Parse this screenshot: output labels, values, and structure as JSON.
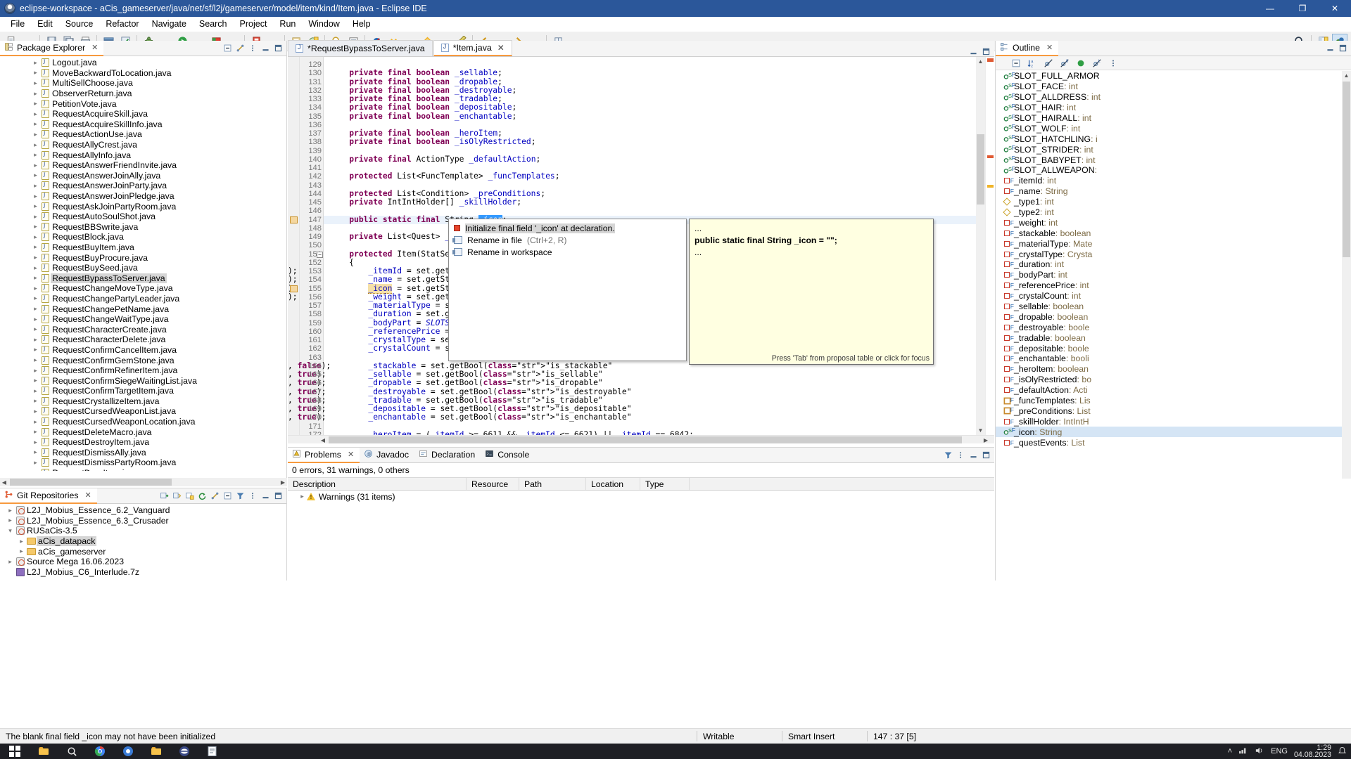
{
  "window": {
    "title": "eclipse-workspace - aCis_gameserver/java/net/sf/l2j/gameserver/model/item/kind/Item.java - Eclipse IDE",
    "minimize": "—",
    "maximize": "❐",
    "close": "✕"
  },
  "menubar": {
    "items": [
      "File",
      "Edit",
      "Source",
      "Refactor",
      "Navigate",
      "Search",
      "Project",
      "Run",
      "Window",
      "Help"
    ]
  },
  "toolbar": {
    "icons": [
      "new-icon",
      "new-dropdown-icon",
      "save-icon",
      "save-all-icon",
      "print-icon",
      "build-all-icon",
      "build-project-icon",
      "debug-icon",
      "run-icon",
      "coverage-icon",
      "external-tools-icon",
      "new-java-project-icon",
      "new-class-icon",
      "search-icon",
      "open-task-icon",
      "skip-breakpoints-icon",
      "next-annotation-icon",
      "previous-annotation-icon",
      "last-edit-location-icon",
      "back-icon",
      "forward-icon",
      "pin-editor-icon"
    ],
    "right_icons": [
      "quick-access-search-icon",
      "open-perspective-icon",
      "java-perspective-icon"
    ]
  },
  "package_explorer": {
    "tab_label": "Package Explorer",
    "close_label": "✕",
    "tools": [
      "collapse-all-icon",
      "link-with-editor-icon",
      "view-menu-icon",
      "minimize-icon",
      "maximize-icon"
    ],
    "items": [
      {
        "label": "Logout.java",
        "selected": false
      },
      {
        "label": "MoveBackwardToLocation.java",
        "selected": false
      },
      {
        "label": "MultiSellChoose.java",
        "selected": false
      },
      {
        "label": "ObserverReturn.java",
        "selected": false
      },
      {
        "label": "PetitionVote.java",
        "selected": false
      },
      {
        "label": "RequestAcquireSkill.java",
        "selected": false
      },
      {
        "label": "RequestAcquireSkillInfo.java",
        "selected": false
      },
      {
        "label": "RequestActionUse.java",
        "selected": false
      },
      {
        "label": "RequestAllyCrest.java",
        "selected": false
      },
      {
        "label": "RequestAllyInfo.java",
        "selected": false
      },
      {
        "label": "RequestAnswerFriendInvite.java",
        "selected": false
      },
      {
        "label": "RequestAnswerJoinAlly.java",
        "selected": false
      },
      {
        "label": "RequestAnswerJoinParty.java",
        "selected": false
      },
      {
        "label": "RequestAnswerJoinPledge.java",
        "selected": false
      },
      {
        "label": "RequestAskJoinPartyRoom.java",
        "selected": false
      },
      {
        "label": "RequestAutoSoulShot.java",
        "selected": false
      },
      {
        "label": "RequestBBSwrite.java",
        "selected": false
      },
      {
        "label": "RequestBlock.java",
        "selected": false
      },
      {
        "label": "RequestBuyItem.java",
        "selected": false
      },
      {
        "label": "RequestBuyProcure.java",
        "selected": false
      },
      {
        "label": "RequestBuySeed.java",
        "selected": false
      },
      {
        "label": "RequestBypassToServer.java",
        "selected": true
      },
      {
        "label": "RequestChangeMoveType.java",
        "selected": false
      },
      {
        "label": "RequestChangePartyLeader.java",
        "selected": false
      },
      {
        "label": "RequestChangePetName.java",
        "selected": false
      },
      {
        "label": "RequestChangeWaitType.java",
        "selected": false
      },
      {
        "label": "RequestCharacterCreate.java",
        "selected": false
      },
      {
        "label": "RequestCharacterDelete.java",
        "selected": false
      },
      {
        "label": "RequestConfirmCancelItem.java",
        "selected": false
      },
      {
        "label": "RequestConfirmGemStone.java",
        "selected": false
      },
      {
        "label": "RequestConfirmRefinerItem.java",
        "selected": false
      },
      {
        "label": "RequestConfirmSiegeWaitingList.java",
        "selected": false
      },
      {
        "label": "RequestConfirmTargetItem.java",
        "selected": false
      },
      {
        "label": "RequestCrystallizeItem.java",
        "selected": false
      },
      {
        "label": "RequestCursedWeaponList.java",
        "selected": false
      },
      {
        "label": "RequestCursedWeaponLocation.java",
        "selected": false
      },
      {
        "label": "RequestDeleteMacro.java",
        "selected": false
      },
      {
        "label": "RequestDestroyItem.java",
        "selected": false
      },
      {
        "label": "RequestDismissAlly.java",
        "selected": false
      },
      {
        "label": "RequestDismissPartyRoom.java",
        "selected": false
      },
      {
        "label": "RequestDropItem.java",
        "selected": false
      }
    ]
  },
  "git_repositories": {
    "tab_label": "Git Repositories",
    "close_label": "✕",
    "tools": [
      "add-repo-icon",
      "clone-repo-icon",
      "create-repo-icon",
      "refresh-icon",
      "link-icon",
      "collapse-all-icon",
      "filter-icon",
      "view-menu-icon",
      "minimize-icon",
      "maximize-icon"
    ],
    "items": [
      {
        "label": "L2J_Mobius_Essence_6.2_Vanguard",
        "indent": 0,
        "icon": "repo-icon",
        "arrow": true,
        "selected": false
      },
      {
        "label": "L2J_Mobius_Essence_6.3_Crusader",
        "indent": 0,
        "icon": "repo-icon",
        "arrow": true,
        "selected": false
      },
      {
        "label": "RUSaCis-3.5",
        "indent": 0,
        "icon": "repo-icon",
        "arrow": true,
        "expanded": true,
        "selected": false
      },
      {
        "label": "aCis_datapack",
        "indent": 1,
        "icon": "folder-icon",
        "arrow": true,
        "selected": true
      },
      {
        "label": "aCis_gameserver",
        "indent": 1,
        "icon": "folder-icon",
        "arrow": true,
        "selected": false
      },
      {
        "label": "Source Mega 16.06.2023",
        "indent": 0,
        "icon": "repo-icon",
        "arrow": true,
        "selected": false
      },
      {
        "label": "L2J_Mobius_C6_Interlude.7z",
        "indent": 0,
        "icon": "archive-icon",
        "arrow": false,
        "selected": false
      }
    ]
  },
  "editor": {
    "tabs": [
      {
        "label": "*RequestBypassToServer.java",
        "active": false,
        "closable": false
      },
      {
        "label": "*Item.java",
        "active": true,
        "closable": true
      }
    ],
    "close_label": "✕",
    "tools": [
      "minimize-icon",
      "maximize-icon"
    ],
    "first_line": 129,
    "lines": [
      {
        "n": 129,
        "text": ""
      },
      {
        "n": 130,
        "text": "    private final boolean _sellable;"
      },
      {
        "n": 131,
        "text": "    private final boolean _dropable;"
      },
      {
        "n": 132,
        "text": "    private final boolean _destroyable;"
      },
      {
        "n": 133,
        "text": "    private final boolean _tradable;"
      },
      {
        "n": 134,
        "text": "    private final boolean _depositable;"
      },
      {
        "n": 135,
        "text": "    private final boolean _enchantable;"
      },
      {
        "n": 136,
        "text": ""
      },
      {
        "n": 137,
        "text": "    private final boolean _heroItem;"
      },
      {
        "n": 138,
        "text": "    private final boolean _isOlyRestricted;"
      },
      {
        "n": 139,
        "text": ""
      },
      {
        "n": 140,
        "text": "    private final ActionType _defaultAction;"
      },
      {
        "n": 141,
        "text": ""
      },
      {
        "n": 142,
        "text": "    protected List<FuncTemplate> _funcTemplates;"
      },
      {
        "n": 143,
        "text": ""
      },
      {
        "n": 144,
        "text": "    protected List<Condition> _preConditions;"
      },
      {
        "n": 145,
        "text": "    private IntIntHolder[] _skillHolder;"
      },
      {
        "n": 146,
        "text": ""
      },
      {
        "n": 147,
        "text": "    public static final String _icon;"
      },
      {
        "n": 148,
        "text": ""
      },
      {
        "n": 149,
        "text": "    private List<Quest> _questEvents;"
      },
      {
        "n": 150,
        "text": ""
      },
      {
        "n": 151,
        "text": "    protected Item(StatSet set)"
      },
      {
        "n": 152,
        "text": "    {"
      },
      {
        "n": 153,
        "text": "        _itemId = set.getInteger(\"item_id\");"
      },
      {
        "n": 154,
        "text": "        _name = set.getString(\"name\");"
      },
      {
        "n": 155,
        "text": "        _icon = set.getString(\"icon\");"
      },
      {
        "n": 156,
        "text": "        _weight = set.getInteger(\"weight\");"
      },
      {
        "n": 157,
        "text": "        _materialType = set.getEnum(...);"
      },
      {
        "n": 158,
        "text": "        _duration = set.getInteger(...);"
      },
      {
        "n": 159,
        "text": "        _bodyPart = SLOTS.get(set...);"
      },
      {
        "n": 160,
        "text": "        _referencePrice = set.ge..."
      },
      {
        "n": 161,
        "text": "        _crystalType = set.getEnu..."
      },
      {
        "n": 162,
        "text": "        _crystalCount = set.getI..."
      },
      {
        "n": 163,
        "text": ""
      },
      {
        "n": 164,
        "text": "        _stackable = set.getBool(\"is_stackable\", false);"
      },
      {
        "n": 165,
        "text": "        _sellable = set.getBool(\"is_sellable\", true);"
      },
      {
        "n": 166,
        "text": "        _dropable = set.getBool(\"is_dropable\", true);"
      },
      {
        "n": 167,
        "text": "        _destroyable = set.getBool(\"is_destroyable\", true);"
      },
      {
        "n": 168,
        "text": "        _tradable = set.getBool(\"is_tradable\", true);"
      },
      {
        "n": 169,
        "text": "        _depositable = set.getBool(\"is_depositable\", true);"
      },
      {
        "n": 170,
        "text": "        _enchantable = set.getBool(\"is_enchantable\", true);"
      },
      {
        "n": 171,
        "text": ""
      },
      {
        "n": 172,
        "text": "        _heroItem = (_itemId >= 6611 && _itemId <= 6621) || _itemId == 6842;"
      }
    ],
    "selected_token": "_icon",
    "cursor_line": 147,
    "error_lines": [
      147,
      155
    ]
  },
  "quickfix": {
    "items": [
      {
        "label": "Initialize final field '_icon' at declaration.",
        "hint": "",
        "icon": "error-bulb-icon",
        "selected": true
      },
      {
        "label": "Rename in file",
        "hint": "(Ctrl+2, R)",
        "icon": "rename-icon",
        "selected": false
      },
      {
        "label": "Rename in workspace",
        "hint": "",
        "icon": "rename-icon",
        "selected": false
      }
    ]
  },
  "javadoc_popup": {
    "ellipsis_top": "...",
    "signature": "public static final String _icon = \"\";",
    "ellipsis_bottom": "...",
    "footer": "Press 'Tab' from proposal table or click for focus"
  },
  "bottom_view": {
    "tabs": [
      {
        "label": "Problems",
        "active": true,
        "icon": "problems-icon",
        "closable": true
      },
      {
        "label": "Javadoc",
        "active": false,
        "icon": "javadoc-icon",
        "closable": false
      },
      {
        "label": "Declaration",
        "active": false,
        "icon": "declaration-icon",
        "closable": false
      },
      {
        "label": "Console",
        "active": false,
        "icon": "console-icon",
        "closable": false
      }
    ],
    "close_label": "✕",
    "tools": [
      "filter-icon",
      "view-menu-icon",
      "minimize-icon",
      "maximize-icon"
    ],
    "summary": "0 errors, 31 warnings, 0 others",
    "columns": [
      "Description",
      "Resource",
      "Path",
      "Location",
      "Type"
    ],
    "rows": [
      {
        "description": "Warnings (31 items)",
        "resource": "",
        "path": "",
        "location": "",
        "type": "",
        "icon": "warning-icon",
        "arrow": true
      }
    ]
  },
  "outline": {
    "tab_label": "Outline",
    "close_label": "✕",
    "tools": [
      "collapse-all-icon",
      "sort-icon",
      "hide-fields-icon",
      "hide-static-icon",
      "hide-nonpublic-icon",
      "hide-local-icon",
      "view-menu-icon",
      "minimize-icon",
      "maximize-icon"
    ],
    "items": [
      {
        "name": "SLOT_FULL_ARMOR",
        "type": "",
        "kind": "static-final-field",
        "selected": false
      },
      {
        "name": "SLOT_FACE",
        "type": ": int",
        "kind": "static-final-field",
        "selected": false
      },
      {
        "name": "SLOT_ALLDRESS",
        "type": ": int",
        "kind": "static-final-field",
        "selected": false
      },
      {
        "name": "SLOT_HAIR",
        "type": ": int",
        "kind": "static-final-field",
        "selected": false
      },
      {
        "name": "SLOT_HAIRALL",
        "type": ": int",
        "kind": "static-final-field",
        "selected": false
      },
      {
        "name": "SLOT_WOLF",
        "type": ": int",
        "kind": "static-final-field",
        "selected": false
      },
      {
        "name": "SLOT_HATCHLING",
        "type": ": i",
        "kind": "static-final-field",
        "selected": false
      },
      {
        "name": "SLOT_STRIDER",
        "type": ": int",
        "kind": "static-final-field",
        "selected": false
      },
      {
        "name": "SLOT_BABYPET",
        "type": ": int",
        "kind": "static-final-field",
        "selected": false
      },
      {
        "name": "SLOT_ALLWEAPON",
        "type": ":",
        "kind": "static-final-field",
        "selected": false
      },
      {
        "name": "_itemId",
        "type": ": int",
        "kind": "private-field",
        "selected": false
      },
      {
        "name": "_name",
        "type": ": String",
        "kind": "private-field",
        "selected": false
      },
      {
        "name": "_type1",
        "type": ": int",
        "kind": "default-field",
        "selected": false
      },
      {
        "name": "_type2",
        "type": ": int",
        "kind": "default-field",
        "selected": false
      },
      {
        "name": "_weight",
        "type": ": int",
        "kind": "private-field",
        "selected": false
      },
      {
        "name": "_stackable",
        "type": ": boolean",
        "kind": "private-field",
        "selected": false
      },
      {
        "name": "_materialType",
        "type": ": Mate",
        "kind": "private-field",
        "selected": false
      },
      {
        "name": "_crystalType",
        "type": ": Crysta",
        "kind": "private-field",
        "selected": false
      },
      {
        "name": "_duration",
        "type": ": int",
        "kind": "private-field",
        "selected": false
      },
      {
        "name": "_bodyPart",
        "type": ": int",
        "kind": "private-field",
        "selected": false
      },
      {
        "name": "_referencePrice",
        "type": ": int",
        "kind": "private-field",
        "selected": false
      },
      {
        "name": "_crystalCount",
        "type": ": int",
        "kind": "private-field",
        "selected": false
      },
      {
        "name": "_sellable",
        "type": ": boolean",
        "kind": "private-field",
        "selected": false
      },
      {
        "name": "_dropable",
        "type": ": boolean",
        "kind": "private-field",
        "selected": false
      },
      {
        "name": "_destroyable",
        "type": ": boole",
        "kind": "private-field",
        "selected": false
      },
      {
        "name": "_tradable",
        "type": ": boolean",
        "kind": "private-field",
        "selected": false
      },
      {
        "name": "_depositable",
        "type": ": boole",
        "kind": "private-field",
        "selected": false
      },
      {
        "name": "_enchantable",
        "type": ": booli",
        "kind": "private-field",
        "selected": false
      },
      {
        "name": "_heroItem",
        "type": ": boolean",
        "kind": "private-field",
        "selected": false
      },
      {
        "name": "_isOlyRestricted",
        "type": ": bo",
        "kind": "private-field",
        "selected": false
      },
      {
        "name": "_defaultAction",
        "type": ": Acti",
        "kind": "private-field",
        "selected": false
      },
      {
        "name": "_funcTemplates",
        "type": ": Lis",
        "kind": "protected-field",
        "selected": false
      },
      {
        "name": "_preConditions",
        "type": ": List",
        "kind": "protected-field",
        "selected": false
      },
      {
        "name": "_skillHolder",
        "type": ": IntIntH",
        "kind": "private-field",
        "selected": false
      },
      {
        "name": "_icon",
        "type": ": String",
        "kind": "static-final-field",
        "selected": true
      },
      {
        "name": "_questEvents",
        "type": ": List",
        "kind": "private-field",
        "selected": false
      }
    ]
  },
  "statusbar": {
    "message": "The blank final field _icon may not have been initialized",
    "writable": "Writable",
    "insert_mode": "Smart Insert",
    "position": "147 : 37 [5]"
  },
  "taskbar": {
    "start_label": "start-button",
    "apps": [
      "file-explorer-icon",
      "search-icon",
      "chrome-icon",
      "chrome2-icon",
      "folder-icon",
      "eclipse-icon",
      "notepad-icon"
    ],
    "tray": {
      "chevron": "˄",
      "network": "network-icon",
      "volume": "volume-icon",
      "language": "ENG",
      "time": "1:29",
      "date": "04.08.2023",
      "notifications": "notification-icon"
    }
  },
  "colors": {
    "title_bg": "#2b579a",
    "accent_tab": "#f79a3e",
    "keyword": "#7f0055",
    "string": "#2a00ff",
    "field": "#0000c0",
    "selection": "#3399ff",
    "javadoc_bg": "#ffffe1"
  }
}
